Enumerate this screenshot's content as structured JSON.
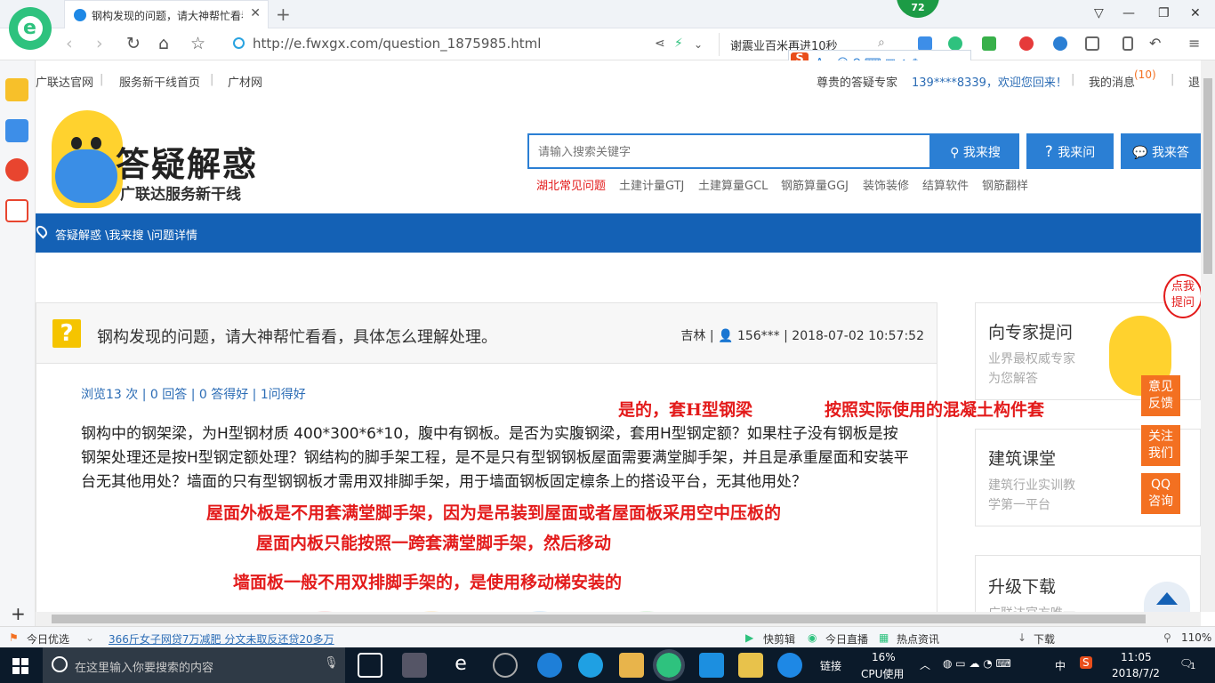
{
  "browser": {
    "tab_title": "钢构发现的问题，请大神帮忙看看...",
    "new_tab": "+",
    "badge": "72",
    "url": "http://e.fwxgx.com/question_1875985.html",
    "top_search": "谢震业百米再进10秒"
  },
  "site_nav": {
    "links": [
      "广联达官网",
      "服务新干线首页",
      "广材网"
    ],
    "user_greeting": "尊贵的答疑专家",
    "user_welcome": "139****8339，欢迎您回来！",
    "messages_label": "我的消息",
    "messages_count": "(10)",
    "logout": "退出"
  },
  "logo": {
    "title": "答疑解惑",
    "subtitle": "广联达服务新干线"
  },
  "search": {
    "placeholder": "请输入搜索关键字",
    "search_btn": "我来搜",
    "ask_btn": "我来问",
    "answer_btn": "我来答",
    "hot_links": [
      "湖北常见问题",
      "土建计量GTJ",
      "土建算量GCL",
      "钢筋算量GGJ",
      "装饰装修",
      "结算软件",
      "钢筋翻样"
    ]
  },
  "breadcrumb": "答疑解惑 \\我来搜 \\问题详情",
  "question": {
    "title": "钢构发现的问题，请大神帮忙看看，具体怎么理解处理。",
    "author": "吉林",
    "user": "156***",
    "datetime": "2018-07-02 10:57:52",
    "stats": "浏览13 次 | 0 回答 | 0 答得好 | 1问得好",
    "body": "钢构中的钢架梁，为H型钢材质 400*300*6*10，腹中有钢板。是否为实腹钢梁，套用H型钢定额？如果柱子没有钢板是按钢架处理还是按H型钢定额处理？钢结构的脚手架工程，是不是只有型钢钢板屋面需要满堂脚手架，并且是承重屋面和安装平台无其他用处？墙面的只有型钢钢板才需用双排脚手架，用于墙面钢板固定檩条上的搭设平台，无其他用处？"
  },
  "annotations": {
    "a1": "是的，套H型钢梁",
    "a2": "按照实际使用的混凝土构件套",
    "a3": "屋面外板是不用套满堂脚手架，因为是吊装到屋面或者屋面板采用空中压板的",
    "a4": "屋面内板只能按照一跨套满堂脚手架，然后移动",
    "a5": "墙面板一般不用双排脚手架的，是使用移动梯安装的"
  },
  "right": {
    "ask_expert_title": "向专家提问",
    "ask_expert_sub": [
      "业界最权威专家",
      "为您解答"
    ],
    "course_title": "建筑课堂",
    "course_sub": [
      "建筑行业实训教",
      "学第一平台"
    ],
    "download_title": "升级下载",
    "download_sub": "广联达官方唯一",
    "float_btns": [
      [
        "意见",
        "反馈"
      ],
      [
        "关注",
        "我们"
      ],
      [
        "QQ",
        "咨询"
      ]
    ],
    "click_bubble": [
      "点我",
      "提问"
    ]
  },
  "statusbar": {
    "today": "今日优选",
    "news": "366斤女子网贷7万减肥 分文未取反还贷20多万",
    "items": [
      "快剪辑",
      "今日直播",
      "热点资讯",
      "下载"
    ],
    "zoom": "110%"
  },
  "taskbar": {
    "search_placeholder": "在这里输入你要搜索的内容",
    "links": "链接",
    "cpu_pct": "16%",
    "cpu_label": "CPU使用",
    "ime": "中",
    "time": "11:05",
    "date": "2018/7/2",
    "notif": "1"
  }
}
